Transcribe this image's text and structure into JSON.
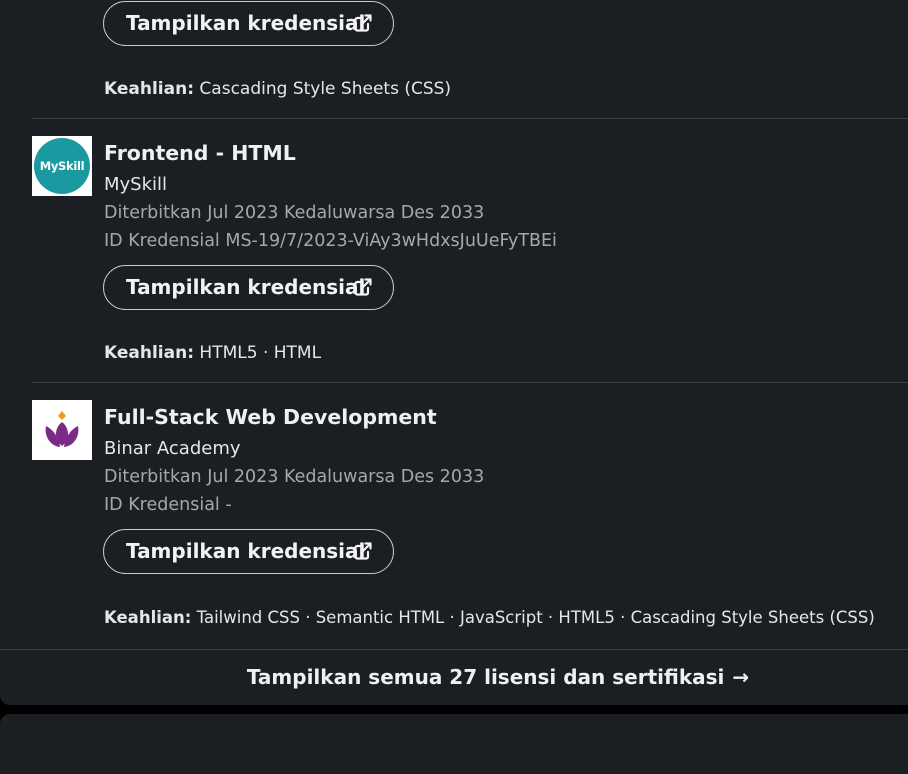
{
  "colors": {
    "card_bg": "#1b1f23",
    "page_bg": "#000000",
    "myskill_teal": "#1a9aa0",
    "binar_purple": "#7b2a85",
    "binar_orange": "#f39a1e"
  },
  "button_label": "Tampilkan kredensial",
  "skills_label": "Keahlian:",
  "top_entry": {
    "skills": "Cascading Style Sheets (CSS)"
  },
  "certs": [
    {
      "title": "Frontend - HTML",
      "issuer": "MySkill",
      "logo_text": "MySkill",
      "dates": "Diterbitkan Jul 2023 Kedaluwarsa Des 2033",
      "credential_id": "ID Kredensial MS-19/7/2023-ViAy3wHdxsJuUeFyTBEi",
      "skills": "HTML5 · HTML"
    },
    {
      "title": "Full-Stack Web Development",
      "issuer": "Binar Academy",
      "dates": "Diterbitkan Jul 2023 Kedaluwarsa Des 2033",
      "credential_id": "ID Kredensial -",
      "skills": "Tailwind CSS · Semantic HTML · JavaScript · HTML5 · Cascading Style Sheets (CSS)"
    }
  ],
  "show_all": {
    "label": "Tampilkan semua 27 lisensi dan sertifikasi",
    "arrow_icon": "arrow-right-icon"
  }
}
